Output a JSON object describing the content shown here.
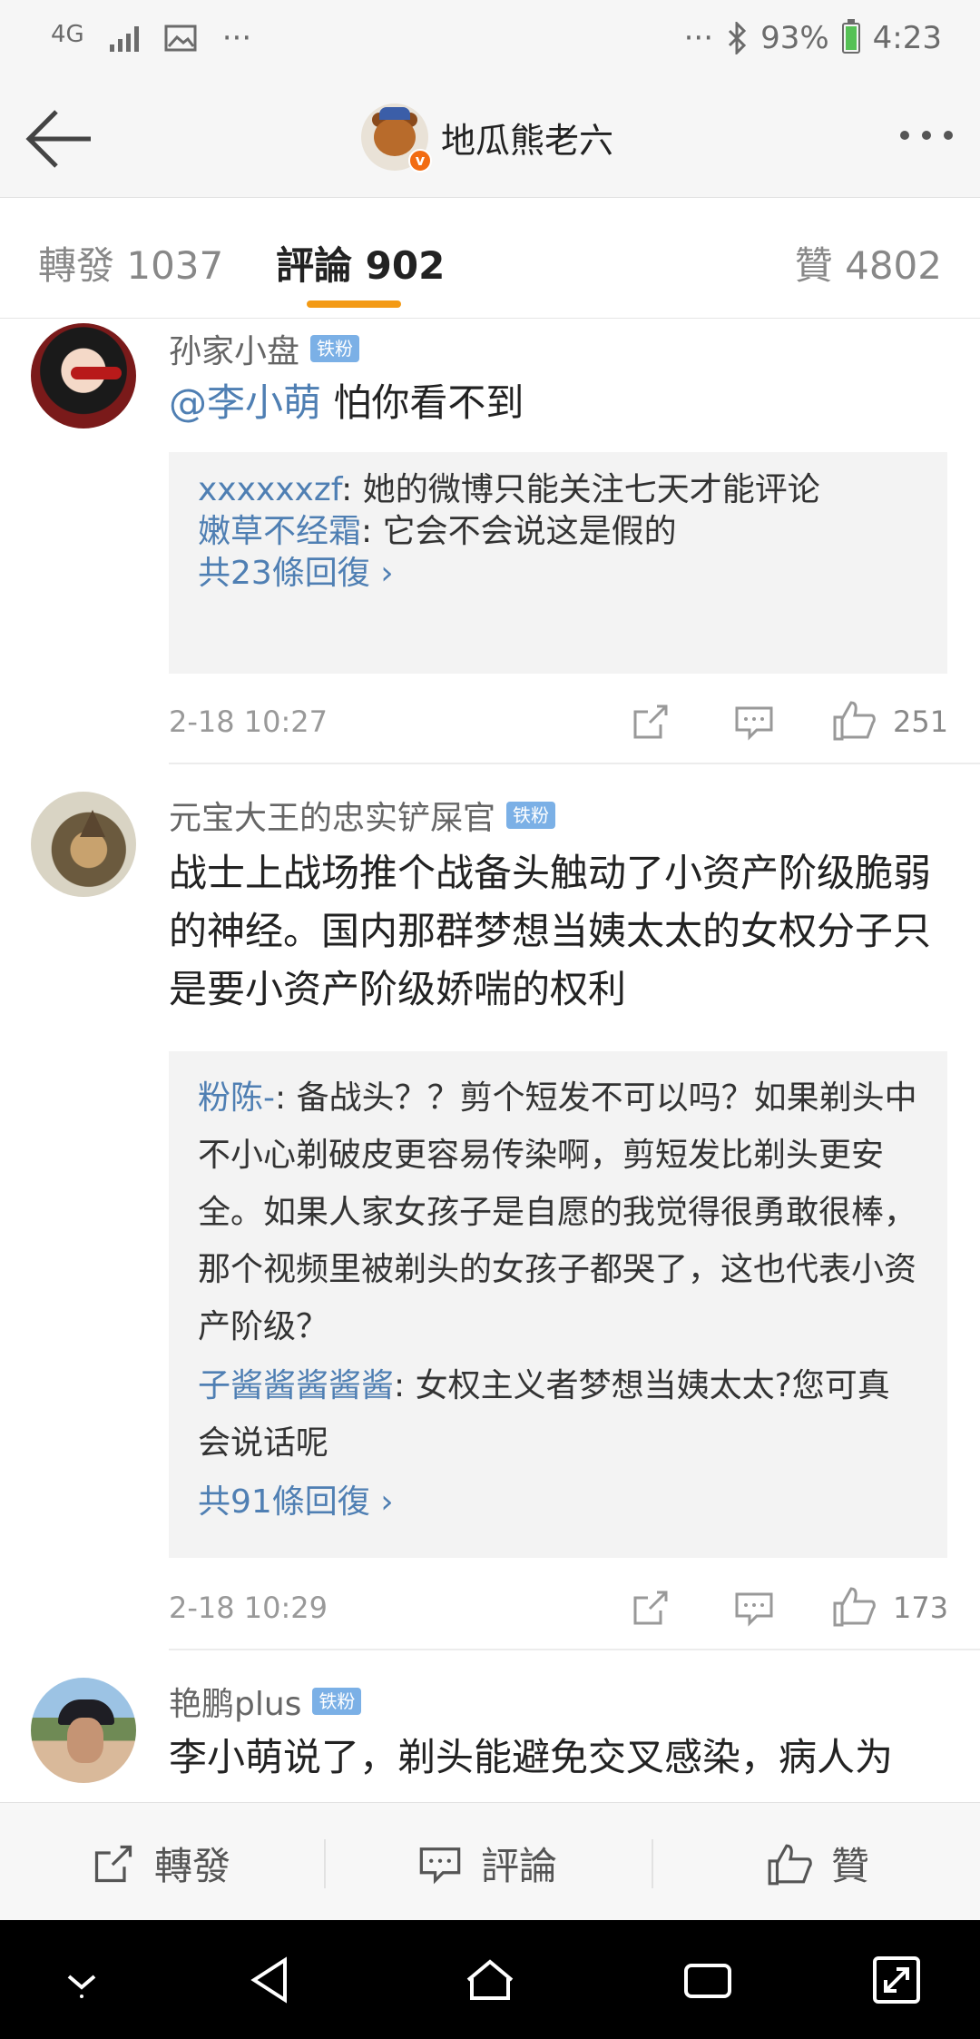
{
  "status_bar": {
    "network": "4G",
    "more_left": "···",
    "more_right": "···",
    "battery": "93%",
    "time": "4:23"
  },
  "header": {
    "title": "地瓜熊老六"
  },
  "tabs": {
    "repost": "轉發 1037",
    "comments": "評論 902",
    "likes": "贊 4802"
  },
  "comments": [
    {
      "name": "孙家小盘",
      "badge": "铁粉",
      "mention": "@李小萌",
      "text": " 怕你看不到",
      "replies": [
        {
          "name": "xxxxxxzf",
          "text": ": 她的微博只能关注七天才能评论"
        },
        {
          "name": "嫩草不经霜",
          "text": ": 它会不会说这是假的"
        }
      ],
      "reply_count": "共23條回復 ›",
      "date": "2-18 10:27",
      "likes": "251"
    },
    {
      "name": "元宝大王的忠实铲屎官",
      "badge": "铁粉",
      "text": "战士上战场推个战备头触动了小资产阶级脆弱的神经。国内那群梦想当姨太太的女权分子只是要小资产阶级娇喘的权利",
      "replies": [
        {
          "name": "粉陈-",
          "text": ": 备战头？？剪个短发不可以吗？如果剃头中不小心剃破皮更容易传染啊，剪短发比剃头更安全。如果人家女孩子是自愿的我觉得很勇敢很棒，那个视频里被剃头的女孩子都哭了，这也代表小资产阶级？"
        },
        {
          "name": "子酱酱酱酱酱",
          "text": ": 女权主义者梦想当姨太太?您可真会说话呢"
        }
      ],
      "reply_count": "共91條回復 ›",
      "date": "2-18 10:29",
      "likes": "173"
    },
    {
      "name": "艳鹏plus",
      "badge": "铁粉",
      "text": "李小萌说了，剃头能避免交叉感染，病人为"
    }
  ],
  "action_bar": {
    "repost": "轉發",
    "comment": "評論",
    "like": "贊"
  }
}
